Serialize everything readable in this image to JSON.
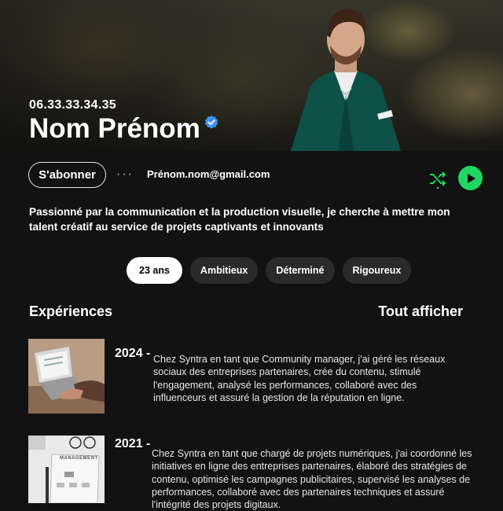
{
  "profile": {
    "phone": "06.33.33.34.35",
    "name": "Nom Prénom",
    "email": "Prénom.nom@gmail.com",
    "subscribe_label": "S'abonner",
    "more_label": "···",
    "bio": "Passionné par la communication et la production visuelle, je cherche à mettre mon talent créatif au service de projets captivants et innovants",
    "tags": [
      "23 ans",
      "Ambitieux",
      "Déterminé",
      "Rigoureux"
    ]
  },
  "experiences": {
    "title": "Expériences",
    "show_all_label": "Tout afficher",
    "items": [
      {
        "year": "2024 -",
        "description": "Chez Syntra en tant que Community manager, j'ai géré les réseaux sociaux des entreprises partenaires, crée du contenu, stimulé l'engagement, analysé les performances, collaboré avec des influenceurs et assuré la gestion de la réputation en ligne."
      },
      {
        "year": "2021 -",
        "description": "Chez Syntra en tant que chargé de projets numériques, j'ai coordonné les initiatives en ligne des entreprises partenaires, élaboré des stratégies de contenu, optimisé les campagnes publicitaires, supervisé les analyses de performances, collaboré avec des partenaires techniques et assuré l'intégrité des projets digitaux.",
        "thumb_text": "MANAGEMENT"
      }
    ]
  },
  "colors": {
    "accent": "#1ed760",
    "verified": "#3d91f5",
    "background": "#121212",
    "tag_bg": "#2a2a2a"
  },
  "icons": [
    "verified-badge-icon",
    "shuffle-icon",
    "play-icon"
  ]
}
